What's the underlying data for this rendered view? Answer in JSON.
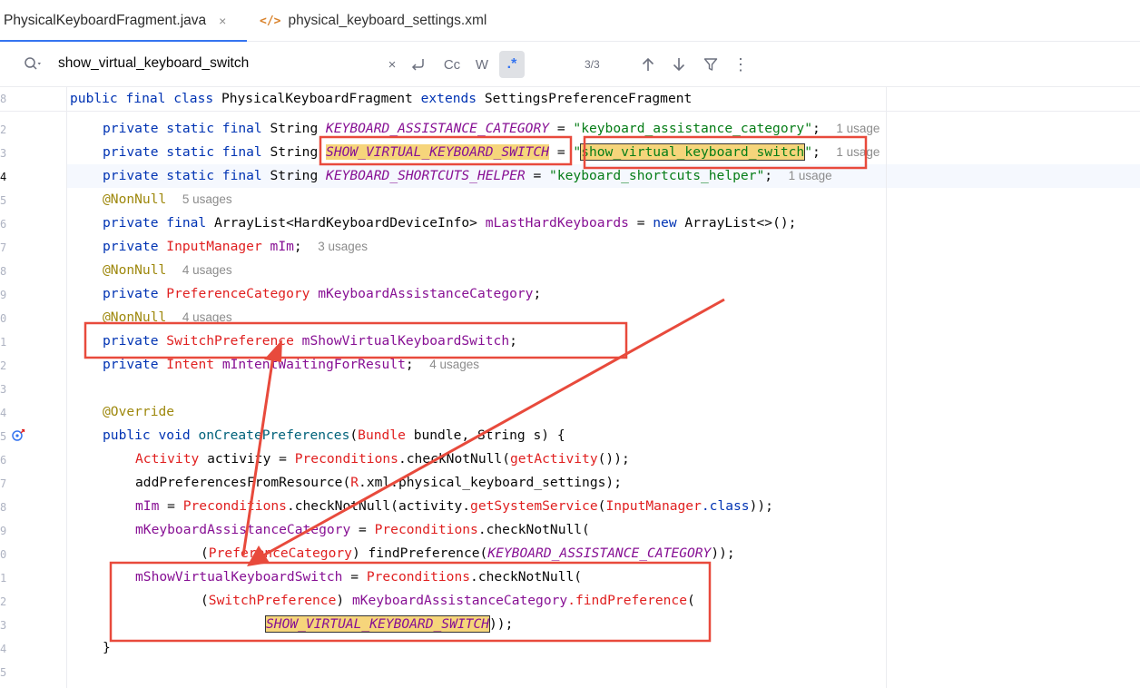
{
  "tabs": [
    {
      "label": "PhysicalKeyboardFragment.java",
      "close": "×"
    },
    {
      "label": "physical_keyboard_settings.xml",
      "icon": "</>"
    }
  ],
  "search": {
    "query": "show_virtual_keyboard_switch",
    "clear": "×",
    "case_label": "Cc",
    "word_label": "W",
    "regex_label": ".*",
    "match_count": "3/3",
    "more": "⋮"
  },
  "colors": {
    "accent": "#3574f0",
    "annotation_red": "#e84a3c",
    "highlight": "#f6d57b"
  },
  "line_numbers": [
    "8",
    "2",
    "3",
    "4",
    "5",
    "6",
    "7",
    "8",
    "9",
    "0",
    "1",
    "2",
    "3",
    "4",
    "5",
    "6",
    "7",
    "8",
    "9",
    "0",
    "1",
    "2",
    "3",
    "4",
    "5"
  ],
  "code": {
    "sticky": {
      "kw": "public final class ",
      "name": "PhysicalKeyboardFragment ",
      "kw2": "extends ",
      "parent": "SettingsPreferenceFragment"
    },
    "l1": {
      "kw": "private static final ",
      "type": "String ",
      "const": "KEYBOARD_ASSISTANCE_CATEGORY",
      "eq": " = ",
      "str": "\"keyboard_assistance_category\"",
      "semi": ";  ",
      "hint": "1 usage"
    },
    "l2": {
      "kw": "private static final ",
      "type": "String ",
      "const": "SHOW_VIRTUAL_KEYBOARD_SWITCH",
      "eq": " = ",
      "q1": "\"",
      "str": "show_virtual_keyboard_switch",
      "q2": "\"",
      "semi": ";  ",
      "hint": "1 usage"
    },
    "l3": {
      "kw": "private static final ",
      "type": "String ",
      "const": "KEYBOARD_SHORTCUTS_HELPER",
      "eq": " = ",
      "str": "\"keyboard_shortcuts_helper\"",
      "semi": ";  ",
      "hint": "1 usage"
    },
    "l4": {
      "ann": "@NonNull",
      "hint": "5 usages"
    },
    "l5": {
      "kw": "private final ",
      "type": "ArrayList<HardKeyboardDeviceInfo> ",
      "field": "mLastHardKeyboards",
      "eq": " = ",
      "kw2": "new ",
      "rest": "ArrayList<>();"
    },
    "l6": {
      "kw": "private ",
      "type": "InputManager ",
      "field": "mIm",
      "semi": ";  ",
      "hint": "3 usages"
    },
    "l7": {
      "ann": "@NonNull",
      "hint": "4 usages"
    },
    "l8": {
      "kw": "private ",
      "type": "PreferenceCategory ",
      "field": "mKeyboardAssistanceCategory",
      "semi": ";"
    },
    "l9": {
      "ann": "@NonNull",
      "hint": "4 usages"
    },
    "l10": {
      "kw": "private ",
      "type": "SwitchPreference ",
      "field": "mShowVirtualKeyboardSwitch",
      "semi": ";"
    },
    "l11": {
      "kw": "private ",
      "type": "Intent ",
      "field": "mIntentWaitingForResult",
      "semi": ";  ",
      "hint": "4 usages"
    },
    "l13": {
      "ann": "@Override"
    },
    "l14": {
      "kw": "public void ",
      "meth": "onCreatePreferences",
      "p1": "(",
      "type1": "Bundle ",
      "p2": "bundle, ",
      "type2": "String ",
      "p3": "s) {"
    },
    "l15": {
      "type": "Activity ",
      "v": "activity = ",
      "cls": "Preconditions",
      "m": ".checkNotNull(",
      "call": "getActivity",
      "end": "());"
    },
    "l16": {
      "a": "addPreferencesFromResource(",
      "r": "R",
      "b": ".xml.physical_keyboard_settings);"
    },
    "l17": {
      "field": "mIm",
      "eq": " = ",
      "cls": "Preconditions",
      "m": ".checkNotNull(activity.",
      "call": "getSystemService",
      "p": "(",
      "type": "InputManager",
      "cls2": ".class",
      "end": "));"
    },
    "l18": {
      "field": "mKeyboardAssistanceCategory",
      "eq": " = ",
      "cls": "Preconditions",
      "m": ".checkNotNull("
    },
    "l19": {
      "p": "(",
      "type": "PreferenceCategory",
      "m": ") findPreference(",
      "const": "KEYBOARD_ASSISTANCE_CATEGORY",
      "end": "));"
    },
    "l20": {
      "field": "mShowVirtualKeyboardSwitch",
      "eq": " = ",
      "cls": "Preconditions",
      "m": ".checkNotNull("
    },
    "l21": {
      "p": "(",
      "type": "SwitchPreference",
      "m": ") ",
      "field": "mKeyboardAssistanceCategory",
      "call": ".findPreference",
      "end": "("
    },
    "l22": {
      "const": "SHOW_VIRTUAL_KEYBOARD_SWITCH",
      "end": "));"
    },
    "l23": {
      "brace": "}"
    }
  }
}
